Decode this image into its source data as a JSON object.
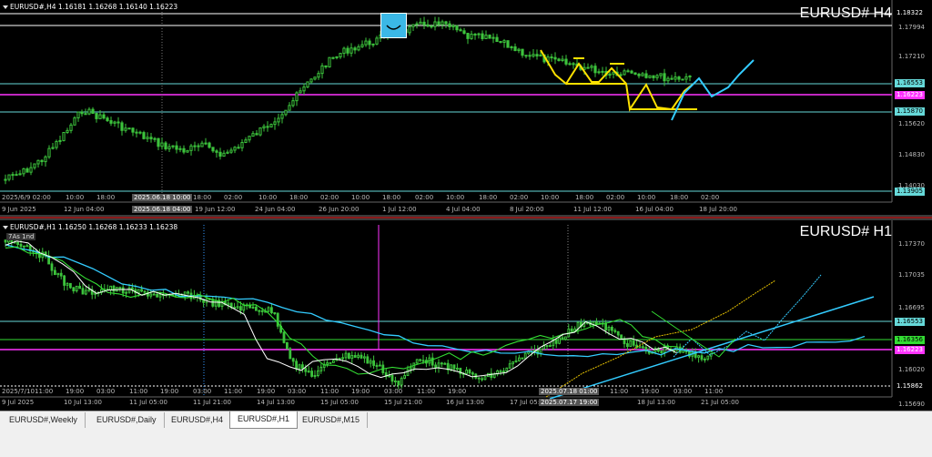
{
  "top": {
    "ohlc": "EURUSD#,H4  1.16181 1.16268 1.16140 1.16223",
    "title": "EURUSD# H4",
    "prices": [
      "1.18322",
      "1.17994",
      "1.17210",
      "1.16553",
      "1.16223",
      "1.15870",
      "1.15620",
      "1.14830",
      "1.14030",
      "1.13905"
    ],
    "price_tags": [
      {
        "text": "1.18322",
        "color": "#ffffff",
        "bg": "#000000"
      },
      {
        "text": "1.16553",
        "color": "#000000",
        "bg": "#66d9d9"
      },
      {
        "text": "1.16223",
        "color": "#ffffff",
        "bg": "#ff33ff"
      },
      {
        "text": "1.15870",
        "color": "#000000",
        "bg": "#66d9d9"
      },
      {
        "text": "1.13905",
        "color": "#000000",
        "bg": "#66d9d9"
      }
    ],
    "times": [
      "2025/6/9 02:00",
      "10:00",
      "18:00",
      "2025.06.18 10:00",
      "18:00",
      "02:00",
      "10:00",
      "18:00",
      "02:00",
      "10:00",
      "18:00",
      "02:00",
      "10:00",
      "18:00",
      "02:00",
      "10:00",
      "18:00",
      "02:00",
      "10:00",
      "18:00",
      "02:00"
    ],
    "dates": [
      "9 Jun 2025",
      "12 Jun 04:00",
      "2025.06.18 04:00",
      "19 Jun 12:00",
      "24 Jun 04:00",
      "26 Jun 20:00",
      "1 Jul 12:00",
      "4 Jul 04:00",
      "8 Jul 20:00",
      "11 Jul 12:00",
      "16 Jul 04:00",
      "18 Jul 20:00"
    ]
  },
  "bottom": {
    "ohlc": "EURUSD#,H1  1.16250 1.16268 1.16233 1.16238",
    "title": "EURUSD# H1",
    "badge": "7As 1nd",
    "prices": [
      "1.17370",
      "1.17035",
      "1.16695",
      "1.16553",
      "1.16356",
      "1.16223",
      "1.16020",
      "1.15862",
      "1.15690"
    ],
    "price_tags": [
      {
        "text": "1.16553",
        "color": "#000000",
        "bg": "#66d9d9"
      },
      {
        "text": "1.16356",
        "color": "#000000",
        "bg": "#33dd33"
      },
      {
        "text": "1.16223",
        "color": "#ffffff",
        "bg": "#ff33ff"
      },
      {
        "text": "1.15862",
        "color": "#ffffff",
        "bg": "#000000"
      }
    ],
    "times": [
      "2025/7/10",
      "11:00",
      "19:00",
      "03:00",
      "11:00",
      "19:00",
      "03:00",
      "11:00",
      "19:00",
      "03:00",
      "11:00",
      "19:00",
      "03:00",
      "11:00",
      "19:00",
      "2025.07.18 01:00",
      "11:00",
      "19:00",
      "03:00",
      "11:00"
    ],
    "dates": [
      "9 Jul 2025",
      "10 Jul 13:00",
      "11 Jul 05:00",
      "11 Jul 21:00",
      "14 Jul 13:00",
      "15 Jul 05:00",
      "15 Jul 21:00",
      "16 Jul 13:00",
      "17 Jul 05:00",
      "2025.07.17 19:00",
      "18 Jul 13:00",
      "21 Jul 05:00"
    ]
  },
  "tabs": [
    "EURUSD#,Weekly",
    "EURUSD#,Daily",
    "EURUSD#,H4",
    "EURUSD#,H1",
    "EURUSD#,M15"
  ],
  "active_tab": "EURUSD#,H1"
}
